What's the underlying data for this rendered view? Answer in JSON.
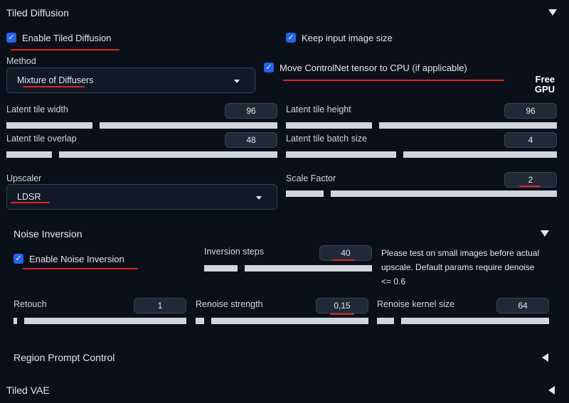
{
  "tiled_diffusion": {
    "title": "Tiled Diffusion",
    "enable_label": "Enable Tiled Diffusion",
    "keep_size_label": "Keep input image size",
    "move_controlnet_label": "Move ControlNet tensor to CPU (if applicable)",
    "method_label": "Method",
    "method_value": "Mixture of Diffusers",
    "free_gpu_label": "Free\nGPU",
    "tile_width_label": "Latent tile width",
    "tile_width_value": "96",
    "tile_width_level": 0.33,
    "tile_height_label": "Latent tile height",
    "tile_height_value": "96",
    "tile_height_level": 0.33,
    "tile_overlap_label": "Latent tile overlap",
    "tile_overlap_value": "48",
    "tile_overlap_level": 0.18,
    "tile_batch_label": "Latent tile batch size",
    "tile_batch_value": "4",
    "tile_batch_level": 0.42,
    "upscaler_label": "Upscaler",
    "upscaler_value": "LDSR",
    "scale_factor_label": "Scale Factor",
    "scale_factor_value": "2"
  },
  "noise_inversion": {
    "title": "Noise Inversion",
    "enable_label": "Enable Noise Inversion",
    "steps_label": "Inversion steps",
    "steps_value": "40",
    "steps_level": 0.22,
    "note": "Please test on small images before actual upscale. Default params require denoise <= 0.6",
    "retouch_label": "Retouch",
    "retouch_value": "1",
    "retouch_level": 0.04,
    "renoise_strength_label": "Renoise strength",
    "renoise_strength_value": "0,15",
    "renoise_strength_level": 0.07,
    "renoise_kernel_label": "Renoise kernel size",
    "renoise_kernel_value": "64",
    "renoise_kernel_level": 0.12
  },
  "region_prompt": {
    "title": "Region Prompt Control"
  },
  "tiled_vae": {
    "title": "Tiled VAE"
  },
  "colors": {
    "background": "#0b0f19",
    "checkbox": "#2563eb",
    "annotation": "#dc2626"
  }
}
